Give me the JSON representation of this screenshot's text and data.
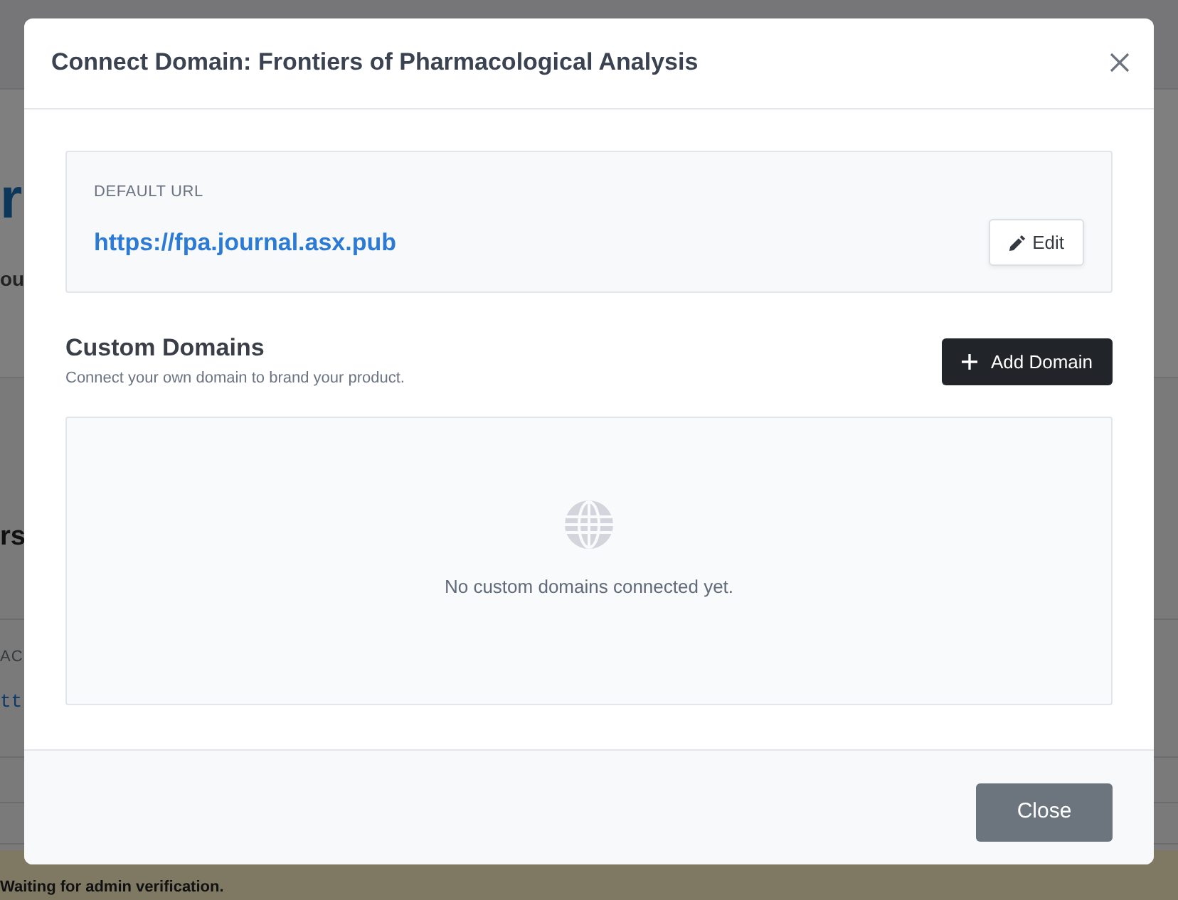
{
  "background_page": {
    "heading": "r",
    "subheading": "ou",
    "section_title": "rs",
    "table_header": "AC",
    "table_cell": "tt",
    "alert": "Waiting for admin verification."
  },
  "modal": {
    "title": "Connect Domain: Frontiers of Pharmacological Analysis",
    "default_url": {
      "label": "DEFAULT URL",
      "url": "https://fpa.journal.asx.pub",
      "edit_button": "Edit"
    },
    "custom_domains": {
      "title": "Custom Domains",
      "description": "Connect your own domain to brand your product.",
      "add_button": "Add Domain",
      "empty_message": "No custom domains connected yet."
    },
    "footer_buttons": [
      "Close"
    ]
  }
}
